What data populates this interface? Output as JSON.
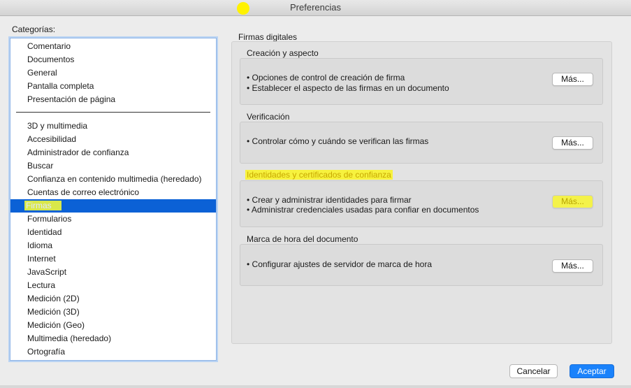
{
  "window": {
    "title": "Preferencias"
  },
  "categories": {
    "label": "Categorías:",
    "group1": [
      "Comentario",
      "Documentos",
      "General",
      "Pantalla completa",
      "Presentación de página"
    ],
    "group2": [
      "3D y multimedia",
      "Accesibilidad",
      "Administrador de confianza",
      "Buscar",
      "Confianza en contenido multimedia (heredado)",
      "Cuentas de correo electrónico",
      "Firmas",
      "Formularios",
      "Identidad",
      "Idioma",
      "Internet",
      "JavaScript",
      "Lectura",
      "Medición (2D)",
      "Medición (3D)",
      "Medición (Geo)",
      "Multimedia (heredado)",
      "Ortografía"
    ],
    "selected": "Firmas"
  },
  "panel": {
    "title": "Firmas digitales",
    "sections": [
      {
        "title": "Creación y aspecto",
        "lines": [
          "• Opciones de control de creación de firma",
          "• Establecer el aspecto de las firmas en un documento"
        ],
        "button": "Más..."
      },
      {
        "title": "Verificación",
        "lines": [
          "• Controlar cómo y cuándo se verifican las firmas"
        ],
        "button": "Más..."
      },
      {
        "title": "Identidades y certificados de confianza",
        "lines": [
          "• Crear y administrar identidades para firmar",
          "• Administrar credenciales usadas para confiar en documentos"
        ],
        "button": "Más..."
      },
      {
        "title": "Marca de hora del documento",
        "lines": [
          "• Configurar ajustes de servidor de marca de hora"
        ],
        "button": "Más..."
      }
    ]
  },
  "footer": {
    "cancel": "Cancelar",
    "accept": "Aceptar"
  },
  "colors": {
    "selection": "#0b61d6",
    "accent_button": "#1a82fb",
    "highlight": "#f7f23e"
  }
}
